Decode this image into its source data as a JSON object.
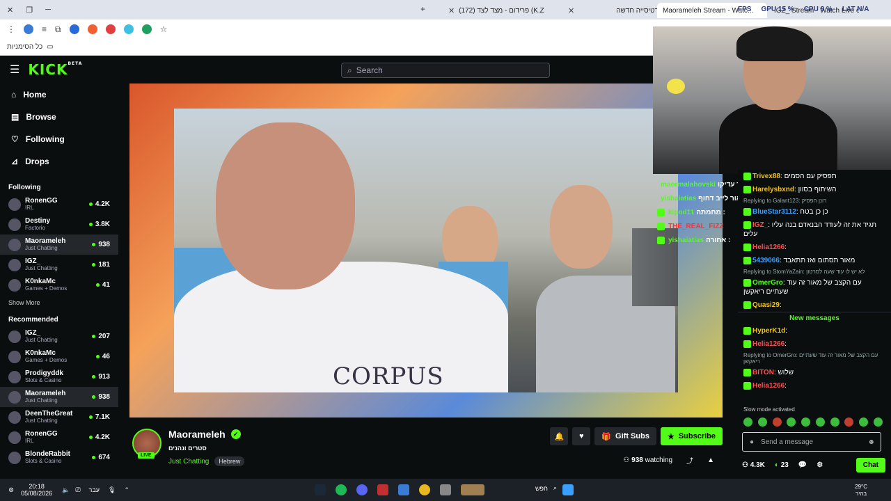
{
  "browser": {
    "tabs": [
      {
        "label": "(172) פרידום - מצד לצד (K.Z",
        "active": false
      },
      {
        "label": "כרטיסייה חדשה",
        "active": false
      },
      {
        "label": "Maorameleh Stream - Watc...",
        "active": true
      },
      {
        "label": "IGZ_ Stream - Watch Live on Ki...",
        "active": false
      }
    ],
    "overlay_stats": {
      "fps": "FPS",
      "gpu": "GPU 15 %",
      "cpu": "CPU 8 %",
      "lat": "LAT N/A"
    },
    "bookmarks_label": "כל הסימניות"
  },
  "kick": {
    "logo": "KICK",
    "logo_sup": "BETA",
    "search_placeholder": "Search",
    "nav": [
      {
        "label": "Home",
        "icon": "home-icon"
      },
      {
        "label": "Browse",
        "icon": "browse-icon"
      },
      {
        "label": "Following",
        "icon": "heart-icon"
      },
      {
        "label": "Drops",
        "icon": "drops-icon"
      }
    ],
    "following_title": "Following",
    "following": [
      {
        "name": "RonenGG",
        "category": "IRL",
        "viewers": "4.2K",
        "selected": false
      },
      {
        "name": "Destiny",
        "category": "Factorio",
        "viewers": "3.8K",
        "selected": false
      },
      {
        "name": "Maorameleh",
        "category": "Just Chatting",
        "viewers": "938",
        "selected": true
      },
      {
        "name": "IGZ_",
        "category": "Just Chatting",
        "viewers": "181",
        "selected": false
      },
      {
        "name": "K0nkaMc",
        "category": "Games + Demos",
        "viewers": "41",
        "selected": false
      }
    ],
    "show_more": "Show More",
    "recommended_title": "Recommended",
    "recommended": [
      {
        "name": "IGZ_",
        "category": "Just Chatting",
        "viewers": "207",
        "selected": false
      },
      {
        "name": "K0nkaMc",
        "category": "Games + Demos",
        "viewers": "46",
        "selected": false
      },
      {
        "name": "Prodigyddk",
        "category": "Slots & Casino",
        "viewers": "913",
        "selected": false
      },
      {
        "name": "Maorameleh",
        "category": "Just Chatting",
        "viewers": "938",
        "selected": true
      },
      {
        "name": "DeenTheGreat",
        "category": "Just Chatting",
        "viewers": "7.1K",
        "selected": false
      },
      {
        "name": "RonenGG",
        "category": "IRL",
        "viewers": "4.2K",
        "selected": false
      },
      {
        "name": "BlondeRabbit",
        "category": "Slots & Casino",
        "viewers": "674",
        "selected": false
      }
    ],
    "video_text": "CORPUS",
    "stream": {
      "name": "Maorameleh",
      "subtitle": "סטרים ונהנים",
      "category": "Just Chatting",
      "tag": "Hebrew",
      "live": "LIVE",
      "gift_label": "Gift Subs",
      "subscribe_label": "Subscribe",
      "watching_count": "938",
      "watching_label": "watching"
    },
    "overlay_chat": [
      {
        "user": "maormalahovski",
        "text": ": מה אומר עדיקו"
      },
      {
        "user": "yishaiatias",
        "text": ": כנס למאור לייב דחוף"
      },
      {
        "user": "kipod11",
        "text": ": מחמתה"
      },
      {
        "user": "THE_REAL_FIZZ",
        "text": ""
      },
      {
        "user": "yishaiatias",
        "text": ": אחורה"
      }
    ],
    "chat": [
      {
        "user": "Trivex88",
        "text": "תפסיק עם הסמים",
        "color": "#f0c419",
        "reply": ""
      },
      {
        "user": "Harelysbxnd",
        "text": "השיתוף בסוון",
        "color": "#f0c419",
        "reply": ""
      },
      {
        "user": "BlueStar3112",
        "text": "כן כן בטח",
        "color": "#3aa0ff",
        "reply": "Replying to Galant123: רונן הפסיק"
      },
      {
        "user": "IGZ_",
        "text": "תגיד את זה לעודד הבנאדם בנה עליו עלים",
        "color": "#ff5050",
        "reply": ""
      },
      {
        "user": "Helia1266",
        "text": "",
        "color": "#ff5050",
        "reply": ""
      },
      {
        "user": "5439066",
        "text": "מאור תסתום ואז תתאבד",
        "color": "#3aa0ff",
        "reply": ""
      },
      {
        "user": "OmerGro",
        "text": "עם הקצב של מאור זה עוד שעתיים ריאקשן",
        "color": "#53fc18",
        "reply": "Replying to StomYaZain: לא יש לו עוד שעה לסרטון"
      },
      {
        "user": "Quasi29",
        "text": "",
        "color": "#f0c419",
        "reply": ""
      }
    ],
    "new_messages": "New messages",
    "chat_after": [
      {
        "user": "HyperK1d",
        "text": "",
        "color": "#f0c419",
        "reply": ""
      },
      {
        "user": "Helia1266",
        "text": "",
        "color": "#ff5050",
        "reply": ""
      },
      {
        "user": "BITON",
        "text": "שלוש",
        "color": "#ff5050",
        "reply": "Replying to OmerGro: עם הקצב של מאור זה עוד שעתיים ריאקשן"
      },
      {
        "user": "Helia1266",
        "text": "",
        "color": "#ff5050",
        "reply": ""
      }
    ],
    "slow_mode": "Slow mode activated",
    "chat_placeholder": "Send a message",
    "chat_footer": {
      "followers": "4.3K",
      "points": "23",
      "chat_button": "Chat"
    }
  },
  "taskbar": {
    "time": "20:18",
    "date": "05/08/2026",
    "lang": "עבר",
    "search": "חפש",
    "weather_temp": "29°C",
    "weather_desc": "בהיר"
  },
  "colors": {
    "accent": "#53fc18",
    "bg": "#0b0e0f"
  }
}
